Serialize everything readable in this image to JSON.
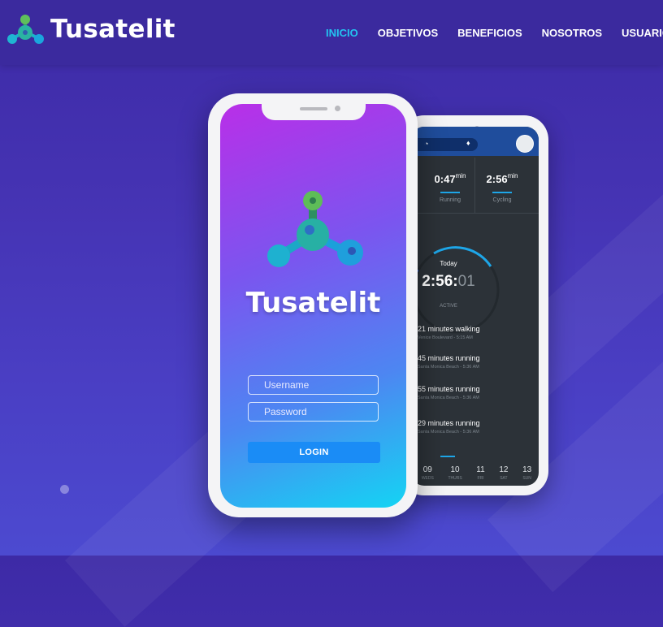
{
  "brand": {
    "name": "Tusatelit",
    "logo_icon": "molecule-icon"
  },
  "nav": {
    "items": [
      {
        "label": "INICIO",
        "active": true
      },
      {
        "label": "OBJETIVOS",
        "active": false
      },
      {
        "label": "BENEFICIOS",
        "active": false
      },
      {
        "label": "NOSOTROS",
        "active": false
      },
      {
        "label": "USUARIOS",
        "active": false
      }
    ]
  },
  "colors": {
    "accent": "#23c4f0",
    "header_bg": "#3b2a9e",
    "login_button": "#1a8cf6"
  },
  "login_phone": {
    "app_name": "Tusatelit",
    "username_placeholder": "Username",
    "password_placeholder": "Password",
    "login_label": "LOGIN"
  },
  "activity_phone": {
    "stats": [
      {
        "value": "0:47",
        "unit": "min",
        "label": "Running"
      },
      {
        "value": "2:56",
        "unit": "min",
        "label": "Cycling"
      }
    ],
    "today_label": "Today",
    "time_main": "2:56:",
    "time_dim": "01",
    "status": "ACTIVE",
    "entries": [
      {
        "title": "21 minutes walking",
        "sub": "Venice Boulevard - 5:15 AM"
      },
      {
        "title": "45 minutes running",
        "sub": "Santa Monica Beach - 5:36 AM"
      },
      {
        "title": "55 minutes running",
        "sub": "Santa Monica Beach - 5:36 AM"
      },
      {
        "title": "29 minutes running",
        "sub": "Santa Monica Beach - 5:36 AM"
      }
    ],
    "days": [
      {
        "num": "09",
        "name": "WEDS"
      },
      {
        "num": "10",
        "name": "THURS"
      },
      {
        "num": "11",
        "name": "FRI"
      },
      {
        "num": "12",
        "name": "SAT"
      },
      {
        "num": "13",
        "name": "SUN"
      }
    ]
  }
}
